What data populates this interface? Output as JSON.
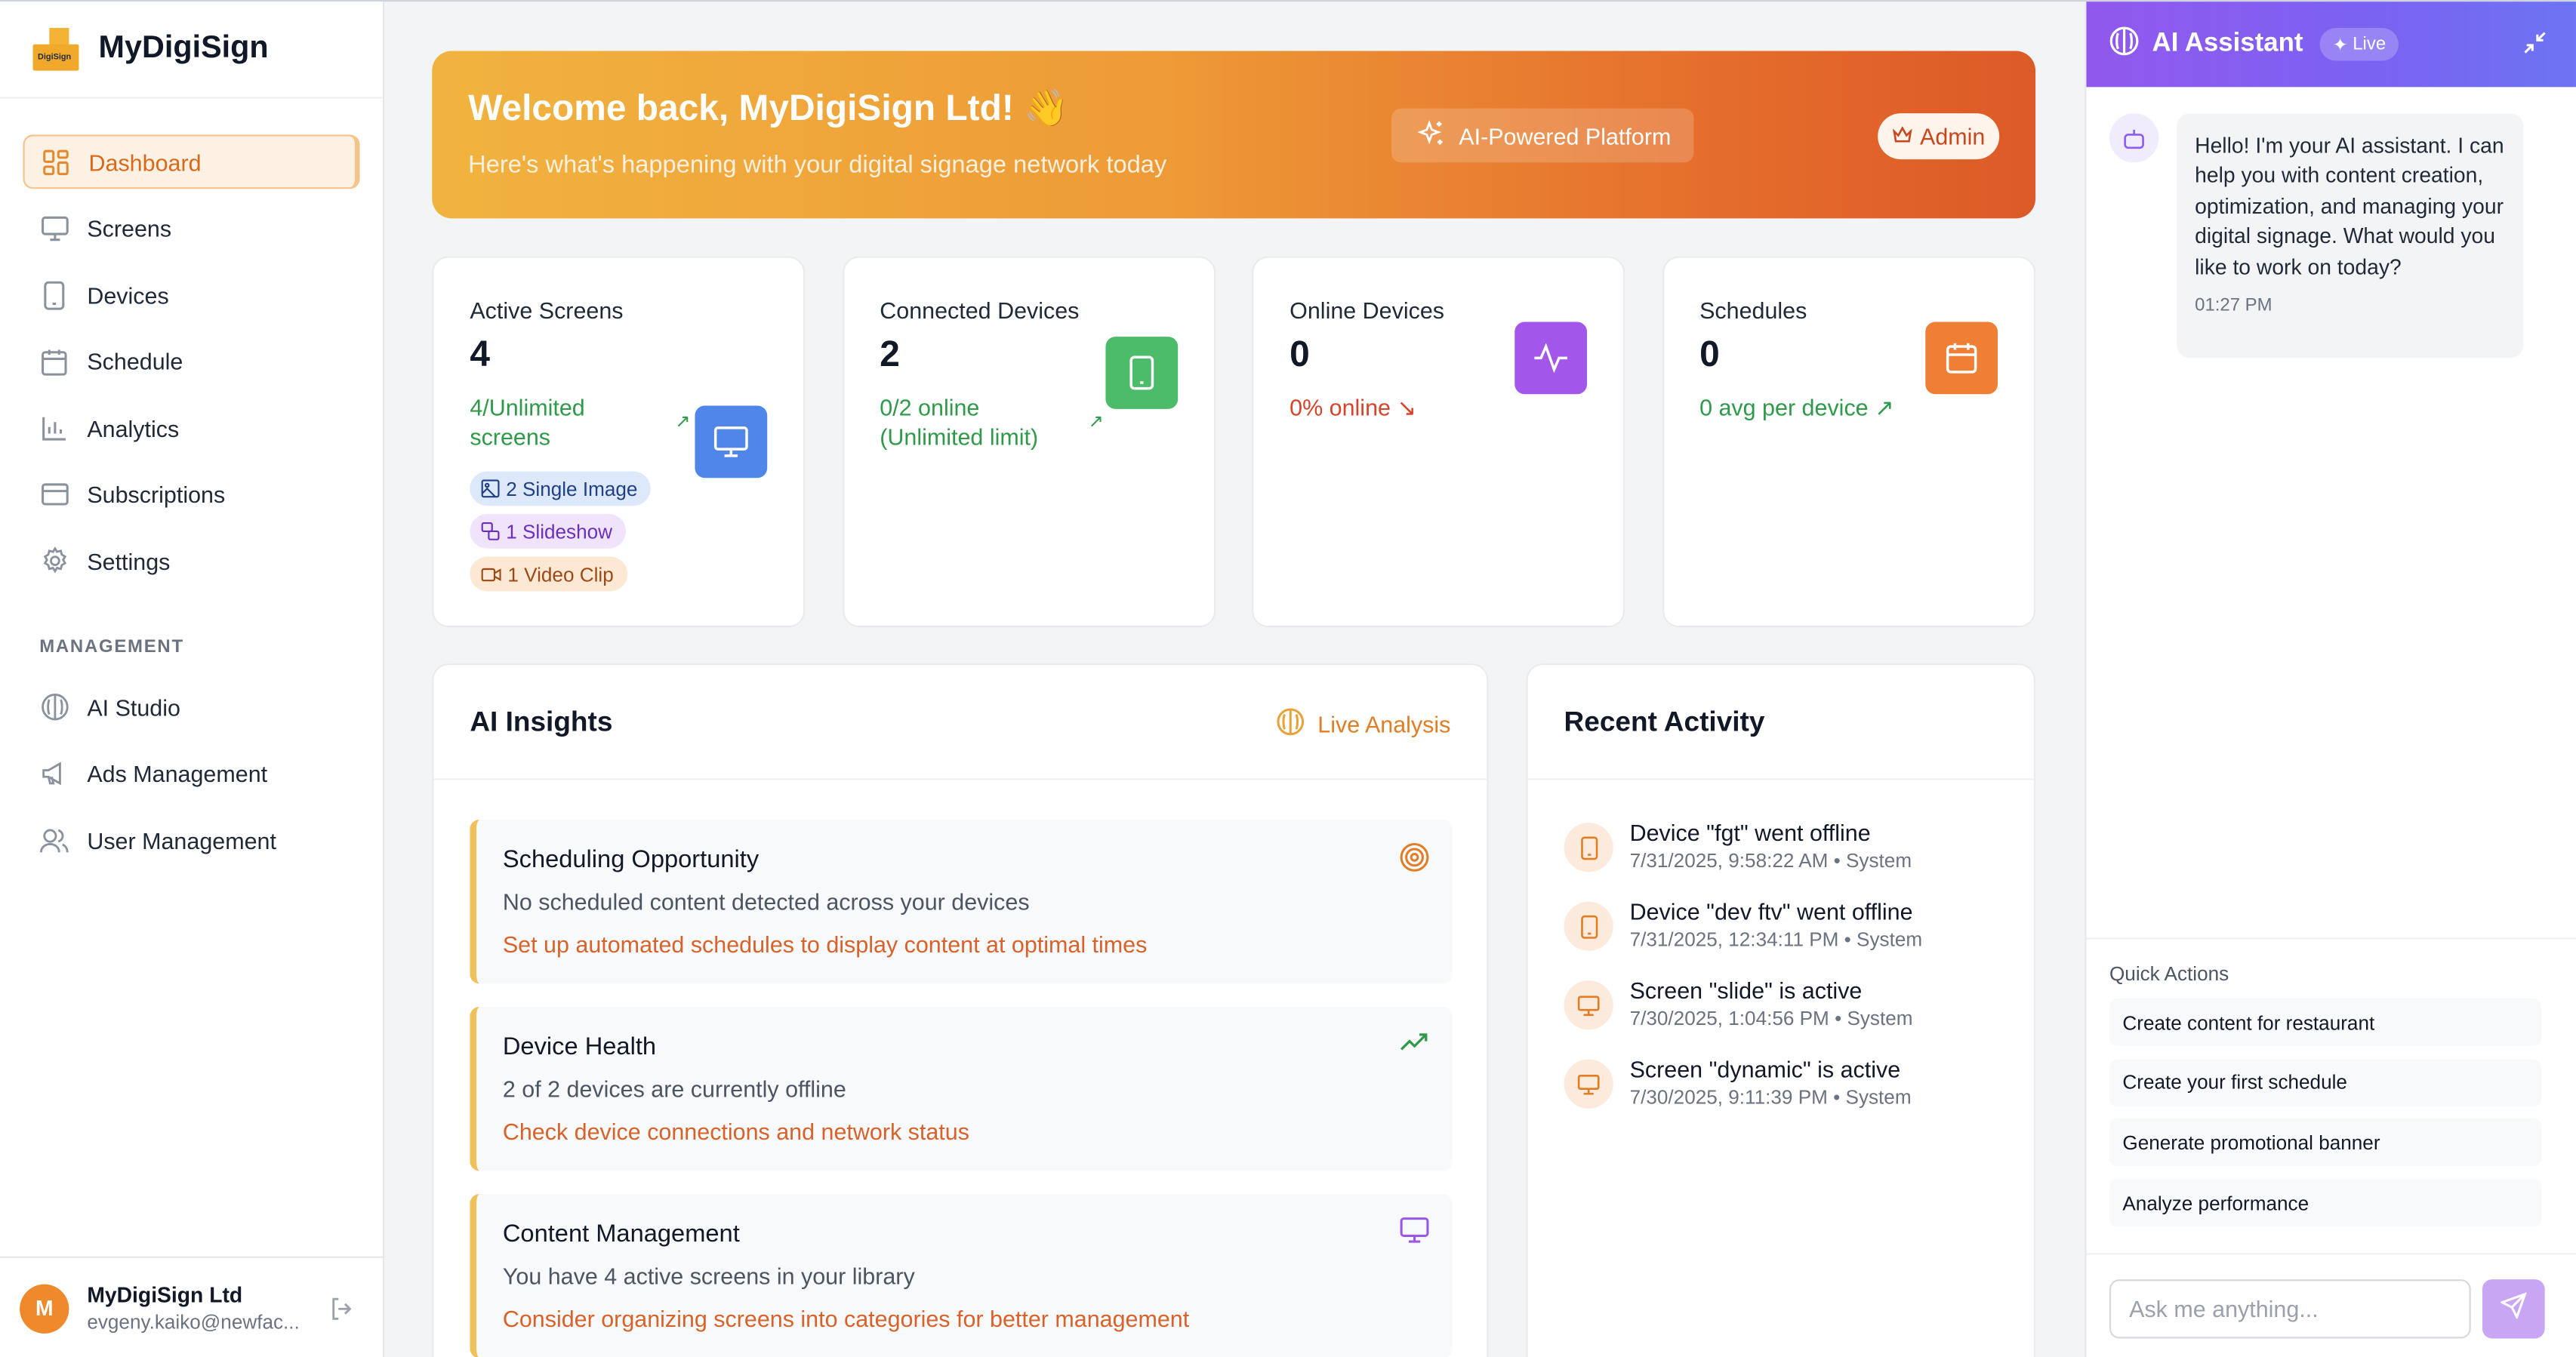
{
  "brand": {
    "name": "MyDigiSign",
    "logo_text": "DigiSign"
  },
  "sidebar": {
    "items": [
      {
        "label": "Dashboard",
        "icon": "dashboard-grid-icon",
        "active": true
      },
      {
        "label": "Screens",
        "icon": "monitor-icon"
      },
      {
        "label": "Devices",
        "icon": "tablet-icon"
      },
      {
        "label": "Schedule",
        "icon": "calendar-icon"
      },
      {
        "label": "Analytics",
        "icon": "bar-chart-icon"
      },
      {
        "label": "Subscriptions",
        "icon": "credit-card-icon"
      },
      {
        "label": "Settings",
        "icon": "gear-icon"
      }
    ],
    "management_label": "MANAGEMENT",
    "management_items": [
      {
        "label": "AI Studio",
        "icon": "brain-icon"
      },
      {
        "label": "Ads Management",
        "icon": "megaphone-icon"
      },
      {
        "label": "User Management",
        "icon": "users-icon"
      }
    ],
    "user": {
      "initial": "M",
      "name": "MyDigiSign Ltd",
      "email": "evgeny.kaiko@newfac..."
    }
  },
  "hero": {
    "title": "Welcome back, MyDigiSign Ltd! 👋",
    "subtitle": "Here's what's happening with your digital signage network today",
    "platform_label": "AI-Powered Platform",
    "admin_label": "Admin"
  },
  "stats": [
    {
      "label": "Active Screens",
      "value": "4",
      "sub": "4/Unlimited screens",
      "color": "#4f86e8",
      "chips": [
        {
          "label": "2 Single Image",
          "icon": "image-icon"
        },
        {
          "label": "1 Slideshow",
          "icon": "slideshow-icon"
        },
        {
          "label": "1 Video Clip",
          "icon": "video-icon"
        }
      ]
    },
    {
      "label": "Connected Devices",
      "value": "2",
      "sub": "0/2 online (Unlimited limit)",
      "color": "#4cbb6a"
    },
    {
      "label": "Online Devices",
      "value": "0",
      "sub": "0% online",
      "color": "#a257ea"
    },
    {
      "label": "Schedules",
      "value": "0",
      "sub": "0 avg per device",
      "color": "#ef7f35"
    }
  ],
  "insights": {
    "title": "AI Insights",
    "live_label": "Live Analysis",
    "items": [
      {
        "title": "Scheduling Opportunity",
        "desc": "No scheduled content detected across your devices",
        "action": "Set up automated schedules to display content at optimal times",
        "icon": "target-icon"
      },
      {
        "title": "Device Health",
        "desc": "2 of 2 devices are currently offline",
        "action": "Check device connections and network status",
        "icon": "trending-up-icon"
      },
      {
        "title": "Content Management",
        "desc": "You have 4 active screens in your library",
        "action": "Consider organizing screens into categories for better management",
        "icon": "monitor-icon"
      }
    ]
  },
  "activity": {
    "title": "Recent Activity",
    "items": [
      {
        "title": "Device \"fgt\" went offline",
        "meta": "7/31/2025, 9:58:22 AM • System",
        "icon": "tablet-icon"
      },
      {
        "title": "Device \"dev ftv\" went offline",
        "meta": "7/31/2025, 12:34:11 PM • System",
        "icon": "tablet-icon"
      },
      {
        "title": "Screen \"slide\" is active",
        "meta": "7/30/2025, 1:04:56 PM • System",
        "icon": "monitor-icon"
      },
      {
        "title": "Screen \"dynamic\" is active",
        "meta": "7/30/2025, 9:11:39 PM • System",
        "icon": "monitor-icon"
      }
    ]
  },
  "assistant": {
    "title": "AI Assistant",
    "live_label": "Live",
    "message": "Hello! I'm your AI assistant. I can help you with content creation, optimization, and managing your digital signage. What would you like to work on today?",
    "time": "01:27 PM",
    "quick_actions_label": "Quick Actions",
    "quick_actions": [
      "Create content for restaurant",
      "Create your first schedule",
      "Generate promotional banner",
      "Analyze performance"
    ],
    "input_placeholder": "Ask me anything..."
  }
}
